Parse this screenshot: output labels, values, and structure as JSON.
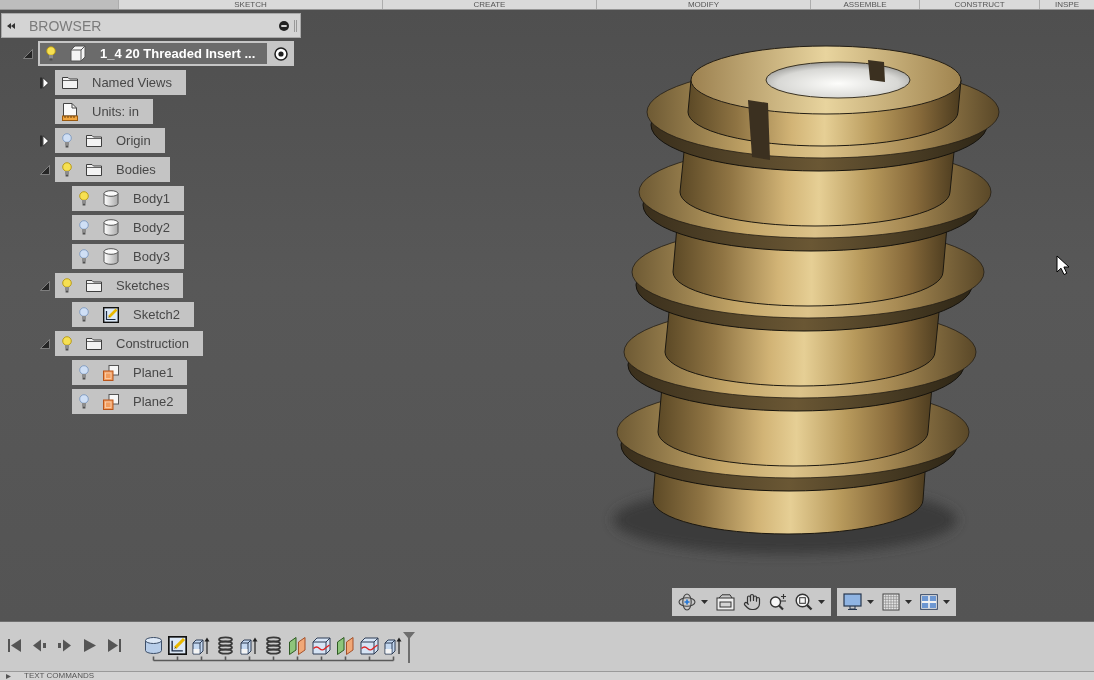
{
  "ribbon": {
    "tabs": [
      {
        "label": "SKETCH"
      },
      {
        "label": "CREATE"
      },
      {
        "label": "MODIFY"
      },
      {
        "label": "ASSEMBLE"
      },
      {
        "label": "CONSTRUCT"
      },
      {
        "label": "INSPE"
      }
    ]
  },
  "browser": {
    "title": "BROWSER",
    "tree": [
      {
        "label": "1_4 20 Threaded Insert ...",
        "kind": "component",
        "visible": true,
        "expanded": true,
        "active": true,
        "children": [
          {
            "label": "Named Views",
            "kind": "folder",
            "expanded": false
          },
          {
            "label": "Units: in",
            "kind": "units"
          },
          {
            "label": "Origin",
            "kind": "folder",
            "visible": false,
            "expanded": false
          },
          {
            "label": "Bodies",
            "kind": "folder",
            "visible": true,
            "expanded": true,
            "children": [
              {
                "label": "Body1",
                "kind": "body",
                "visible": true
              },
              {
                "label": "Body2",
                "kind": "body",
                "visible": false
              },
              {
                "label": "Body3",
                "kind": "body",
                "visible": false
              }
            ]
          },
          {
            "label": "Sketches",
            "kind": "folder",
            "visible": true,
            "expanded": true,
            "children": [
              {
                "label": "Sketch2",
                "kind": "sketch",
                "visible": false
              }
            ]
          },
          {
            "label": "Construction",
            "kind": "folder",
            "visible": true,
            "expanded": true,
            "children": [
              {
                "label": "Plane1",
                "kind": "plane",
                "visible": false
              },
              {
                "label": "Plane2",
                "kind": "plane",
                "visible": false
              }
            ]
          }
        ]
      }
    ]
  },
  "navigation_toolbar": {
    "groups": [
      {
        "tools": [
          {
            "kind": "orbit",
            "dropdown": true
          },
          {
            "kind": "look_at",
            "dropdown": false
          },
          {
            "kind": "pan",
            "dropdown": false
          },
          {
            "kind": "zoom",
            "dropdown": false
          },
          {
            "kind": "fit",
            "dropdown": true
          }
        ]
      },
      {
        "tools": [
          {
            "kind": "display",
            "dropdown": true
          },
          {
            "kind": "grid",
            "dropdown": true
          },
          {
            "kind": "viewports",
            "dropdown": true
          }
        ]
      }
    ]
  },
  "timeline": {
    "controls": [
      {
        "kind": "first"
      },
      {
        "kind": "previous"
      },
      {
        "kind": "next"
      },
      {
        "kind": "play"
      },
      {
        "kind": "last"
      }
    ],
    "features": [
      {
        "kind": "body"
      },
      {
        "kind": "sketch"
      },
      {
        "kind": "extrude"
      },
      {
        "kind": "coil"
      },
      {
        "kind": "extrude"
      },
      {
        "kind": "coil"
      },
      {
        "kind": "split_face"
      },
      {
        "kind": "split_body"
      },
      {
        "kind": "split_face"
      },
      {
        "kind": "split_body"
      },
      {
        "kind": "extrude"
      }
    ]
  },
  "command_bar": {
    "label": "TEXT COMMANDS"
  }
}
